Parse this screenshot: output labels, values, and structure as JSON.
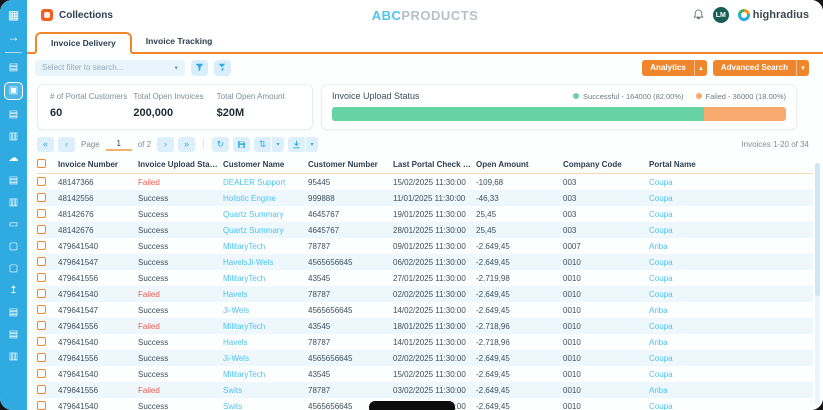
{
  "colors": {
    "accent_orange": "#f0862c",
    "sidebar_blue": "#2fabe1",
    "link_blue": "#4ec3ee",
    "success_green": "#67d3a5",
    "failed_bar_orange": "#f8a96d",
    "failed_text_red": "#ef5a4c"
  },
  "sidebar": {
    "icons": [
      {
        "name": "apps-grid-icon"
      },
      {
        "name": "expand-sidebar-icon"
      },
      {
        "name": "divider"
      },
      {
        "name": "worklist-icon"
      },
      {
        "name": "portal-briefcase-icon",
        "active": true
      },
      {
        "name": "invoice-list-icon"
      },
      {
        "name": "report-icon"
      },
      {
        "name": "cloud-sync-icon"
      },
      {
        "name": "document-icon"
      },
      {
        "name": "notes-icon"
      },
      {
        "name": "card-panel-icon"
      },
      {
        "name": "monitor-icon"
      },
      {
        "name": "desktop-icon"
      },
      {
        "name": "upload-icon"
      },
      {
        "name": "file-report-icon"
      },
      {
        "name": "id-badge-icon"
      },
      {
        "name": "clipboard-icon"
      }
    ]
  },
  "topbar": {
    "app_title": "Collections",
    "brand_primary": "ABC",
    "brand_secondary": "PRODUCTS",
    "avatar_initials": "LM",
    "logo_text": "highradius"
  },
  "tabs": {
    "active": "Invoice Delivery",
    "items": [
      "Invoice Delivery",
      "Invoice Tracking"
    ]
  },
  "filter_bar": {
    "select_placeholder": "Select filter to search...",
    "analytics_label": "Analytics",
    "advanced_search_label": "Advanced Search"
  },
  "kpi_card": {
    "items": [
      {
        "label": "# of Portal Customers",
        "value": "60"
      },
      {
        "label": "Total Open Invoices",
        "value": "200,000"
      },
      {
        "label": "Total Open Amount",
        "value": "$20M"
      }
    ]
  },
  "upload_status": {
    "title": "Invoice Upload Status",
    "legend": [
      {
        "label": "Successful - 164000 (82.00%)",
        "color": "#67d3a5"
      },
      {
        "label": "Failed - 36000 (18.00%)",
        "color": "#f8a96d"
      }
    ],
    "chart": {
      "type": "stacked-bar",
      "successful": 164000,
      "failed": 36000,
      "successful_pct": 82.0,
      "failed_pct": 18.0
    }
  },
  "toolbar": {
    "page_label": "Page",
    "page_value": "1",
    "of_label": "of 2",
    "records_label": "Invoices 1-20 of 34"
  },
  "table": {
    "columns": [
      "Invoice Number",
      "Invoice Upload Status",
      "Customer Name",
      "Customer Number",
      "Last Portal Check Date",
      "Open Amount",
      "Company Code",
      "Portal Name"
    ],
    "rows": [
      {
        "invoice_number": "48147366",
        "status": "Failed",
        "customer_name": "DEALER Support",
        "customer_number": "95445",
        "last_check": "15/02/2025 11:30:00",
        "open_amount": "-109,68",
        "company_code": "003",
        "portal": "Coupa"
      },
      {
        "invoice_number": "48142556",
        "status": "Success",
        "customer_name": "Holistic Engine",
        "customer_number": "999888",
        "last_check": "11/01/2025 11:30:00",
        "open_amount": "-46,33",
        "company_code": "003",
        "portal": "Coupa"
      },
      {
        "invoice_number": "48142676",
        "status": "Success",
        "customer_name": "Quartz Summary",
        "customer_number": "4645767",
        "last_check": "19/01/2025 11:30:00",
        "open_amount": "25,45",
        "company_code": "003",
        "portal": "Coupa"
      },
      {
        "invoice_number": "48142676",
        "status": "Success",
        "customer_name": "Quartz Summary",
        "customer_number": "4645767",
        "last_check": "28/01/2025 11:30:00",
        "open_amount": "25,45",
        "company_code": "003",
        "portal": "Coupa"
      },
      {
        "invoice_number": "479641540",
        "status": "Success",
        "customer_name": "MilitaryTech",
        "customer_number": "78787",
        "last_check": "09/01/2025 11:30:00",
        "open_amount": "-2.649,45",
        "company_code": "0007",
        "portal": "Ariba"
      },
      {
        "invoice_number": "479641547",
        "status": "Success",
        "customer_name": "HavelsJi-Wels",
        "customer_number": "4565656645",
        "last_check": "06/02/2025 11:30:00",
        "open_amount": "-2.649,45",
        "company_code": "0010",
        "portal": "Coupa"
      },
      {
        "invoice_number": "479641556",
        "status": "Success",
        "customer_name": "MilitaryTech",
        "customer_number": "43545",
        "last_check": "27/01/2025 11:30:00",
        "open_amount": "-2.719,98",
        "company_code": "0010",
        "portal": "Coupa"
      },
      {
        "invoice_number": "479641540",
        "status": "Failed",
        "customer_name": "Havels",
        "customer_number": "78787",
        "last_check": "02/02/2025 11:30:00",
        "open_amount": "-2.649,45",
        "company_code": "0010",
        "portal": "Coupa"
      },
      {
        "invoice_number": "479641547",
        "status": "Success",
        "customer_name": "Ji-Wels",
        "customer_number": "4565656645",
        "last_check": "14/02/2025 11:30:00",
        "open_amount": "-2.649,45",
        "company_code": "0010",
        "portal": "Ariba"
      },
      {
        "invoice_number": "479641556",
        "status": "Failed",
        "customer_name": "MilitaryTech",
        "customer_number": "43545",
        "last_check": "18/01/2025 11:30:00",
        "open_amount": "-2.718,96",
        "company_code": "0010",
        "portal": "Coupa"
      },
      {
        "invoice_number": "479641540",
        "status": "Success",
        "customer_name": "Havels",
        "customer_number": "78787",
        "last_check": "14/01/2025 11:30:00",
        "open_amount": "-2.718,96",
        "company_code": "0010",
        "portal": "Ariba"
      },
      {
        "invoice_number": "479641556",
        "status": "Success",
        "customer_name": "Ji-Wels",
        "customer_number": "4565656645",
        "last_check": "02/02/2025 11:30:00",
        "open_amount": "-2.649,45",
        "company_code": "0010",
        "portal": "Coupa"
      },
      {
        "invoice_number": "479641540",
        "status": "Success",
        "customer_name": "MilitaryTech",
        "customer_number": "43545",
        "last_check": "15/02/2025 11:30:00",
        "open_amount": "-2.649,45",
        "company_code": "0010",
        "portal": "Coupa"
      },
      {
        "invoice_number": "479641556",
        "status": "Failed",
        "customer_name": "Swits",
        "customer_number": "78787",
        "last_check": "03/02/2025 11:30:00",
        "open_amount": "-2.649,45",
        "company_code": "0010",
        "portal": "Ariba"
      },
      {
        "invoice_number": "479641540",
        "status": "Success",
        "customer_name": "Swits",
        "customer_number": "4565656645",
        "last_check": "15/02/2025 11:30:00",
        "open_amount": "-2.649,45",
        "company_code": "0010",
        "portal": "Coupa"
      }
    ]
  }
}
